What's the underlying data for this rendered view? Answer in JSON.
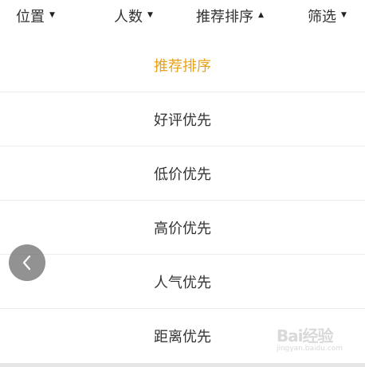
{
  "filter_bar": {
    "tabs": [
      {
        "label": "位置",
        "arrow": "▼"
      },
      {
        "label": "人数",
        "arrow": "▼"
      },
      {
        "label": "推荐排序",
        "arrow": "▲"
      },
      {
        "label": "筛选",
        "arrow": "▼"
      }
    ]
  },
  "sort_menu": {
    "options": [
      {
        "label": "推荐排序",
        "selected": true
      },
      {
        "label": "好评优先"
      },
      {
        "label": "低价优先"
      },
      {
        "label": "高价优先"
      },
      {
        "label": "人气优先"
      },
      {
        "label": "距离优先"
      }
    ]
  },
  "colors": {
    "selected": "#e8a21c",
    "text": "#333333",
    "divider": "#ececec"
  },
  "watermark": {
    "text": "Bai经验",
    "sub": "jingyan.baidu.com"
  },
  "icons": {
    "back": "chevron-left-icon"
  }
}
